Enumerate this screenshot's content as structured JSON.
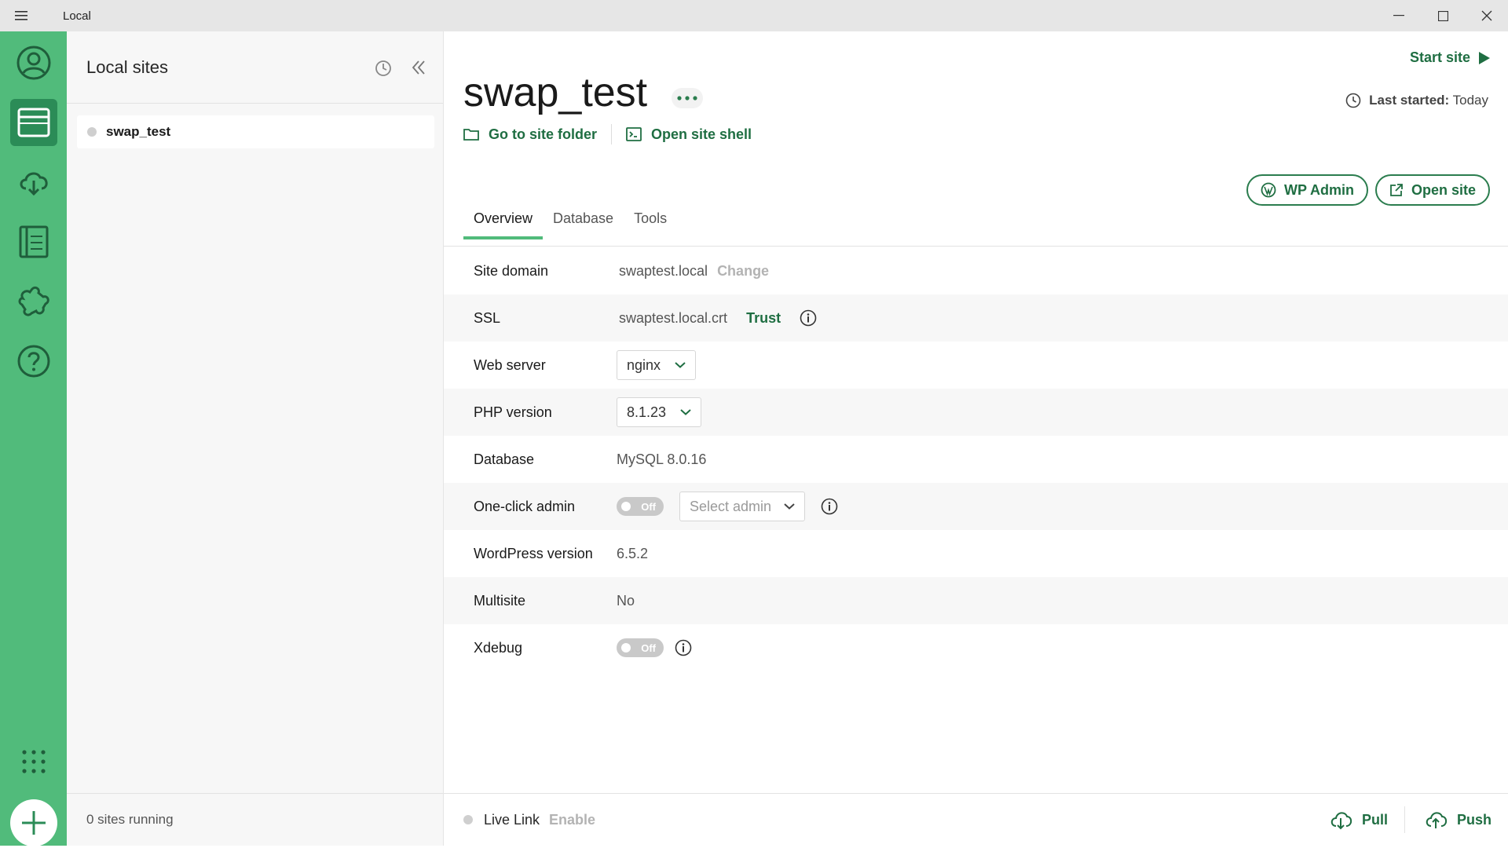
{
  "app": {
    "title": "Local"
  },
  "window": {
    "minimize": "–",
    "maximize": "☐",
    "close": "✕"
  },
  "rail": {
    "items": [
      "account-icon",
      "sites-icon",
      "cloud-icon",
      "blueprints-icon",
      "addons-icon",
      "help-icon"
    ],
    "active": "sites-icon",
    "bottom": [
      "apps-grid-icon",
      "add-site-icon"
    ]
  },
  "sites_panel": {
    "title": "Local sites",
    "sites": [
      {
        "name": "swap_test",
        "status_color": "#cfcfcf"
      }
    ],
    "footer": "0 sites running"
  },
  "site": {
    "name": "swap_test",
    "start_label": "Start site",
    "last_started_label": "Last started:",
    "last_started_value": "Today",
    "go_to_folder": "Go to site folder",
    "open_shell": "Open site shell"
  },
  "tabs": [
    {
      "label": "Overview",
      "active": true
    },
    {
      "label": "Database",
      "active": false
    },
    {
      "label": "Tools",
      "active": false
    }
  ],
  "actions": {
    "wp_admin": "WP Admin",
    "open_site": "Open site"
  },
  "overview": {
    "site_domain": {
      "label": "Site domain",
      "value": "swaptest.local",
      "action": "Change"
    },
    "ssl": {
      "label": "SSL",
      "value": "swaptest.local.crt",
      "action": "Trust"
    },
    "web_server": {
      "label": "Web server",
      "value": "nginx"
    },
    "php_version": {
      "label": "PHP version",
      "value": "8.1.23"
    },
    "database": {
      "label": "Database",
      "value": "MySQL 8.0.16"
    },
    "one_click_admin": {
      "label": "One-click admin",
      "toggle": "Off",
      "select_placeholder": "Select admin"
    },
    "wordpress_version": {
      "label": "WordPress version",
      "value": "6.5.2"
    },
    "multisite": {
      "label": "Multisite",
      "value": "No"
    },
    "xdebug": {
      "label": "Xdebug",
      "toggle": "Off"
    }
  },
  "footer": {
    "live_link": "Live Link",
    "live_link_action": "Enable",
    "pull": "Pull",
    "push": "Push"
  },
  "colors": {
    "brand_green": "#51bb7b",
    "dark_green": "#1f6e42",
    "active_rail": "#2b8c57"
  }
}
